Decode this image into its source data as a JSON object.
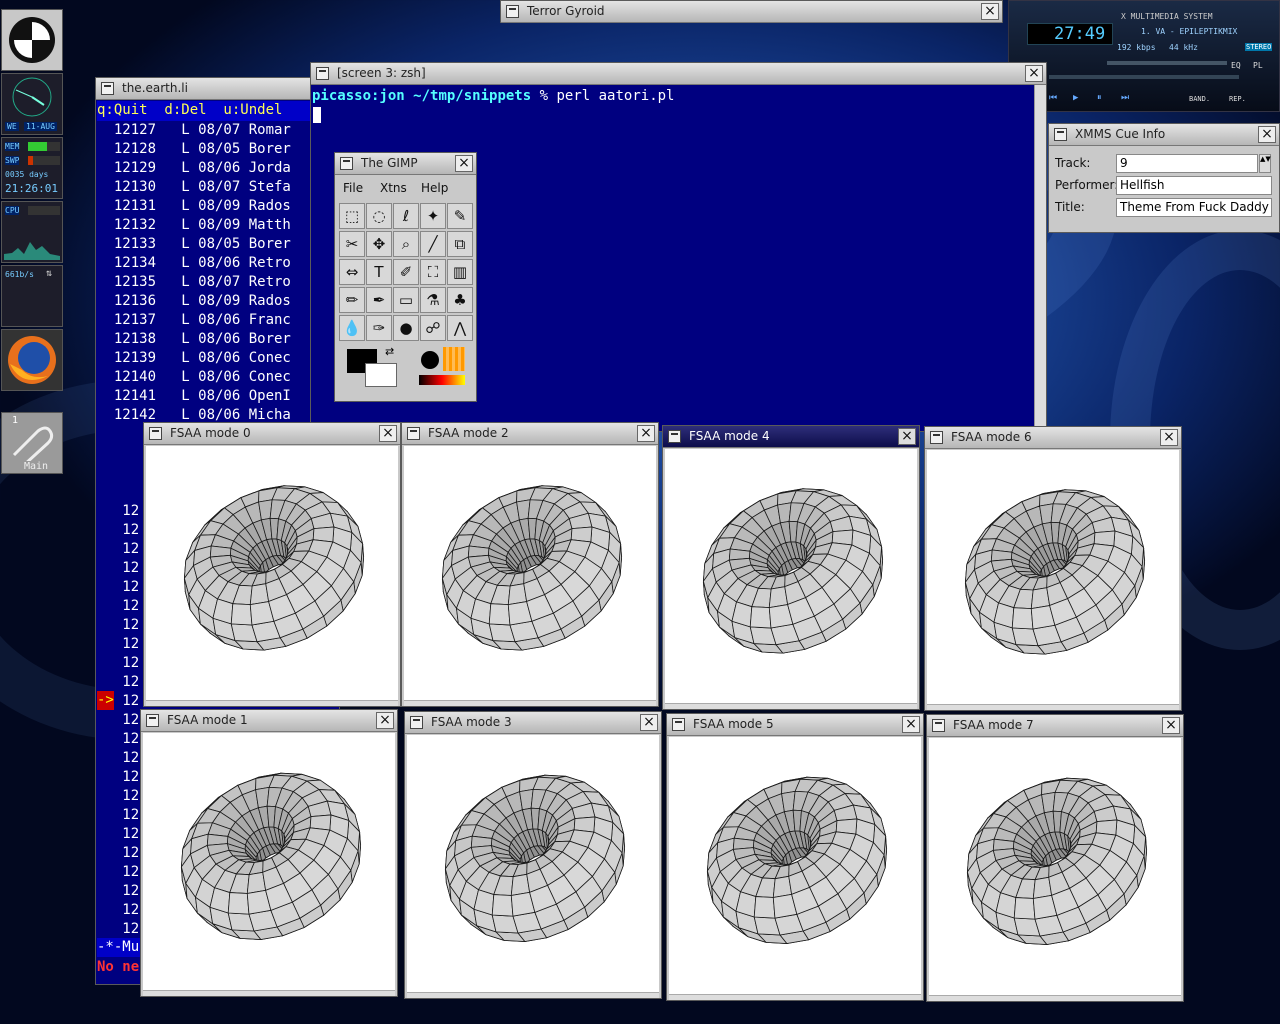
{
  "windows": {
    "terror": {
      "title": "Terror Gyroid"
    },
    "earth": {
      "title": "the.earth.li",
      "menu": "q:Quit  d:Del  u:Undel",
      "rows": [
        "  12127   L 08/07 Romar",
        "  12128   L 08/05 Borer",
        "  12129   L 08/06 Jorda",
        "  12130   L 08/07 Stefa",
        "  12131   L 08/09 Rados",
        "  12132   L 08/09 Matth",
        "  12133   L 08/05 Borer",
        "  12134   L 08/06 Retro",
        "  12135   L 08/07 Retro",
        "  12136   L 08/09 Rados",
        "  12137   L 08/06 Franc",
        "  12138   L 08/06 Borer",
        "  12139   L 08/06 Conec",
        "  12140   L 08/06 Conec",
        "  12141   L 08/06 OpenI",
        "  12142   L 08/06 Micha"
      ],
      "row_prefix": "12",
      "arrow": "->",
      "status_line": "-*-Mu",
      "bottom_line": "No ne"
    },
    "screen": {
      "title": "[screen 3: zsh]",
      "prompt_user": "picasso:jon",
      "prompt_path": "~/tmp/snippets",
      "prompt_symbol": "%",
      "command": "perl aatori.pl"
    },
    "gimp": {
      "title": "The GIMP",
      "menu": [
        "File",
        "Xtns",
        "Help"
      ]
    },
    "cue": {
      "title": "XMMS Cue Info",
      "track_label": "Track:",
      "track": "9",
      "performer_label": "Performer:",
      "performer": "Hellfish",
      "title_label": "Title:",
      "title_value": "Theme From Fuck Daddy (I"
    },
    "fsaa": [
      {
        "title": "FSAA mode 0"
      },
      {
        "title": "FSAA mode 2"
      },
      {
        "title": "FSAA mode 4"
      },
      {
        "title": "FSAA mode 6"
      },
      {
        "title": "FSAA mode 1"
      },
      {
        "title": "FSAA mode 3"
      },
      {
        "title": "FSAA mode 5"
      },
      {
        "title": "FSAA mode 7"
      }
    ]
  },
  "xmms": {
    "brand": "X MULTIMEDIA SYSTEM",
    "time": "27:49",
    "song": "1. VA - EPILEPTIKMIX",
    "bitrate": "192 kbps",
    "rate": "44 kHz",
    "stereo": "STEREO",
    "eq": "EQ",
    "pl": "PL",
    "band": "BAND.",
    "rep": "REP."
  },
  "dock": {
    "day": "WE",
    "date": "11-AUG",
    "mem": "MEM",
    "swp": "SWP",
    "uptime_days": "0035 days",
    "uptime_time": "21:26:01",
    "cpu": "CPU",
    "net": "661b/s",
    "desk_num": "1",
    "desk_name": "Main"
  },
  "colors": {
    "terminal_bg": "#000080",
    "prompt_cyan": "#55ffff",
    "accent_red": "#cc0000"
  }
}
